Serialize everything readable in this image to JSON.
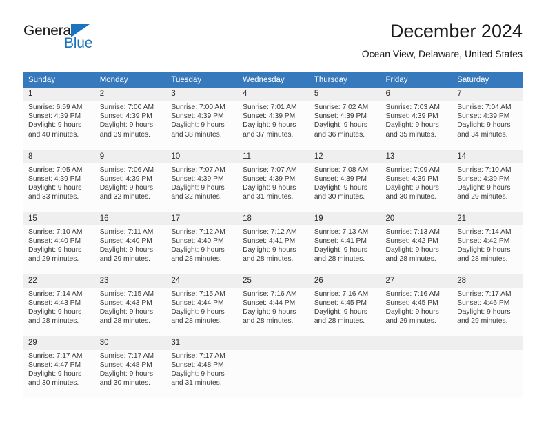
{
  "brand": {
    "name_top": "General",
    "name_bottom": "Blue",
    "accent_color": "#1c75bc"
  },
  "header": {
    "month_title": "December 2024",
    "location": "Ocean View, Delaware, United States"
  },
  "calendar": {
    "header_bg": "#3779bd",
    "daynum_bg": "#efefef",
    "weekday_headers": [
      "Sunday",
      "Monday",
      "Tuesday",
      "Wednesday",
      "Thursday",
      "Friday",
      "Saturday"
    ],
    "weeks": [
      [
        {
          "day": "1",
          "sunrise": "Sunrise: 6:59 AM",
          "sunset": "Sunset: 4:39 PM",
          "daylight1": "Daylight: 9 hours",
          "daylight2": "and 40 minutes."
        },
        {
          "day": "2",
          "sunrise": "Sunrise: 7:00 AM",
          "sunset": "Sunset: 4:39 PM",
          "daylight1": "Daylight: 9 hours",
          "daylight2": "and 39 minutes."
        },
        {
          "day": "3",
          "sunrise": "Sunrise: 7:00 AM",
          "sunset": "Sunset: 4:39 PM",
          "daylight1": "Daylight: 9 hours",
          "daylight2": "and 38 minutes."
        },
        {
          "day": "4",
          "sunrise": "Sunrise: 7:01 AM",
          "sunset": "Sunset: 4:39 PM",
          "daylight1": "Daylight: 9 hours",
          "daylight2": "and 37 minutes."
        },
        {
          "day": "5",
          "sunrise": "Sunrise: 7:02 AM",
          "sunset": "Sunset: 4:39 PM",
          "daylight1": "Daylight: 9 hours",
          "daylight2": "and 36 minutes."
        },
        {
          "day": "6",
          "sunrise": "Sunrise: 7:03 AM",
          "sunset": "Sunset: 4:39 PM",
          "daylight1": "Daylight: 9 hours",
          "daylight2": "and 35 minutes."
        },
        {
          "day": "7",
          "sunrise": "Sunrise: 7:04 AM",
          "sunset": "Sunset: 4:39 PM",
          "daylight1": "Daylight: 9 hours",
          "daylight2": "and 34 minutes."
        }
      ],
      [
        {
          "day": "8",
          "sunrise": "Sunrise: 7:05 AM",
          "sunset": "Sunset: 4:39 PM",
          "daylight1": "Daylight: 9 hours",
          "daylight2": "and 33 minutes."
        },
        {
          "day": "9",
          "sunrise": "Sunrise: 7:06 AM",
          "sunset": "Sunset: 4:39 PM",
          "daylight1": "Daylight: 9 hours",
          "daylight2": "and 32 minutes."
        },
        {
          "day": "10",
          "sunrise": "Sunrise: 7:07 AM",
          "sunset": "Sunset: 4:39 PM",
          "daylight1": "Daylight: 9 hours",
          "daylight2": "and 32 minutes."
        },
        {
          "day": "11",
          "sunrise": "Sunrise: 7:07 AM",
          "sunset": "Sunset: 4:39 PM",
          "daylight1": "Daylight: 9 hours",
          "daylight2": "and 31 minutes."
        },
        {
          "day": "12",
          "sunrise": "Sunrise: 7:08 AM",
          "sunset": "Sunset: 4:39 PM",
          "daylight1": "Daylight: 9 hours",
          "daylight2": "and 30 minutes."
        },
        {
          "day": "13",
          "sunrise": "Sunrise: 7:09 AM",
          "sunset": "Sunset: 4:39 PM",
          "daylight1": "Daylight: 9 hours",
          "daylight2": "and 30 minutes."
        },
        {
          "day": "14",
          "sunrise": "Sunrise: 7:10 AM",
          "sunset": "Sunset: 4:39 PM",
          "daylight1": "Daylight: 9 hours",
          "daylight2": "and 29 minutes."
        }
      ],
      [
        {
          "day": "15",
          "sunrise": "Sunrise: 7:10 AM",
          "sunset": "Sunset: 4:40 PM",
          "daylight1": "Daylight: 9 hours",
          "daylight2": "and 29 minutes."
        },
        {
          "day": "16",
          "sunrise": "Sunrise: 7:11 AM",
          "sunset": "Sunset: 4:40 PM",
          "daylight1": "Daylight: 9 hours",
          "daylight2": "and 29 minutes."
        },
        {
          "day": "17",
          "sunrise": "Sunrise: 7:12 AM",
          "sunset": "Sunset: 4:40 PM",
          "daylight1": "Daylight: 9 hours",
          "daylight2": "and 28 minutes."
        },
        {
          "day": "18",
          "sunrise": "Sunrise: 7:12 AM",
          "sunset": "Sunset: 4:41 PM",
          "daylight1": "Daylight: 9 hours",
          "daylight2": "and 28 minutes."
        },
        {
          "day": "19",
          "sunrise": "Sunrise: 7:13 AM",
          "sunset": "Sunset: 4:41 PM",
          "daylight1": "Daylight: 9 hours",
          "daylight2": "and 28 minutes."
        },
        {
          "day": "20",
          "sunrise": "Sunrise: 7:13 AM",
          "sunset": "Sunset: 4:42 PM",
          "daylight1": "Daylight: 9 hours",
          "daylight2": "and 28 minutes."
        },
        {
          "day": "21",
          "sunrise": "Sunrise: 7:14 AM",
          "sunset": "Sunset: 4:42 PM",
          "daylight1": "Daylight: 9 hours",
          "daylight2": "and 28 minutes."
        }
      ],
      [
        {
          "day": "22",
          "sunrise": "Sunrise: 7:14 AM",
          "sunset": "Sunset: 4:43 PM",
          "daylight1": "Daylight: 9 hours",
          "daylight2": "and 28 minutes."
        },
        {
          "day": "23",
          "sunrise": "Sunrise: 7:15 AM",
          "sunset": "Sunset: 4:43 PM",
          "daylight1": "Daylight: 9 hours",
          "daylight2": "and 28 minutes."
        },
        {
          "day": "24",
          "sunrise": "Sunrise: 7:15 AM",
          "sunset": "Sunset: 4:44 PM",
          "daylight1": "Daylight: 9 hours",
          "daylight2": "and 28 minutes."
        },
        {
          "day": "25",
          "sunrise": "Sunrise: 7:16 AM",
          "sunset": "Sunset: 4:44 PM",
          "daylight1": "Daylight: 9 hours",
          "daylight2": "and 28 minutes."
        },
        {
          "day": "26",
          "sunrise": "Sunrise: 7:16 AM",
          "sunset": "Sunset: 4:45 PM",
          "daylight1": "Daylight: 9 hours",
          "daylight2": "and 28 minutes."
        },
        {
          "day": "27",
          "sunrise": "Sunrise: 7:16 AM",
          "sunset": "Sunset: 4:45 PM",
          "daylight1": "Daylight: 9 hours",
          "daylight2": "and 29 minutes."
        },
        {
          "day": "28",
          "sunrise": "Sunrise: 7:17 AM",
          "sunset": "Sunset: 4:46 PM",
          "daylight1": "Daylight: 9 hours",
          "daylight2": "and 29 minutes."
        }
      ],
      [
        {
          "day": "29",
          "sunrise": "Sunrise: 7:17 AM",
          "sunset": "Sunset: 4:47 PM",
          "daylight1": "Daylight: 9 hours",
          "daylight2": "and 30 minutes."
        },
        {
          "day": "30",
          "sunrise": "Sunrise: 7:17 AM",
          "sunset": "Sunset: 4:48 PM",
          "daylight1": "Daylight: 9 hours",
          "daylight2": "and 30 minutes."
        },
        {
          "day": "31",
          "sunrise": "Sunrise: 7:17 AM",
          "sunset": "Sunset: 4:48 PM",
          "daylight1": "Daylight: 9 hours",
          "daylight2": "and 31 minutes."
        },
        {
          "day": "",
          "sunrise": "",
          "sunset": "",
          "daylight1": "",
          "daylight2": ""
        },
        {
          "day": "",
          "sunrise": "",
          "sunset": "",
          "daylight1": "",
          "daylight2": ""
        },
        {
          "day": "",
          "sunrise": "",
          "sunset": "",
          "daylight1": "",
          "daylight2": ""
        },
        {
          "day": "",
          "sunrise": "",
          "sunset": "",
          "daylight1": "",
          "daylight2": ""
        }
      ]
    ]
  }
}
